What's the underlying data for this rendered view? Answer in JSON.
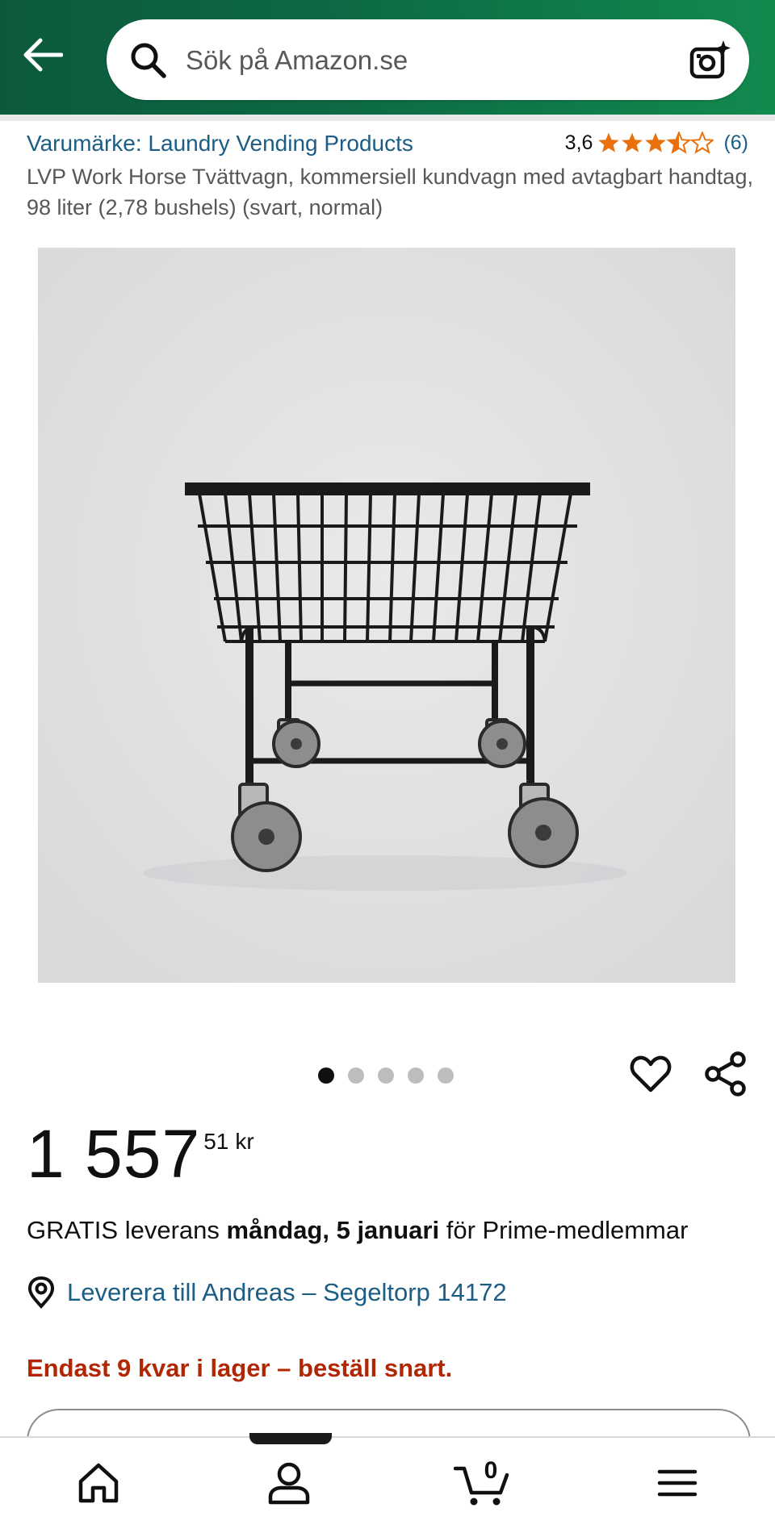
{
  "header": {
    "back_icon": "arrow-left-icon",
    "search": {
      "placeholder": "Sök på Amazon.se",
      "icon": "search-icon"
    },
    "camera_icon": "camera-sparkle-icon"
  },
  "product": {
    "brand": "Varumärke: Laundry Vending Products",
    "rating": {
      "value": "3,6",
      "stars": 3.6,
      "count": "(6)"
    },
    "title": "LVP Work Horse Tvättvagn, kommersiell kundvagn med avtagbart handtag, 98 liter (2,78 bushels) (svart, normal)",
    "image_alt": "Svart tvättvagn med trådkorg på hjul",
    "gallery": {
      "total": 5,
      "active": 1
    },
    "price": {
      "whole": "1 557",
      "fraction": "51",
      "currency": "kr"
    },
    "delivery": {
      "prefix": "GRATIS leverans",
      "date": "måndag, 5 januari",
      "suffix": "för Prime-medlemmar"
    },
    "deliver_to": "Leverera till Andreas – Segeltorp 14172",
    "stock": "Endast 9 kvar i lager – beställ snart."
  },
  "bottom_nav": {
    "cart_count": "0"
  },
  "colors": {
    "header": "#0d6a44",
    "link": "#1b5d85",
    "star": "#e8700d",
    "alert": "#b12704"
  }
}
